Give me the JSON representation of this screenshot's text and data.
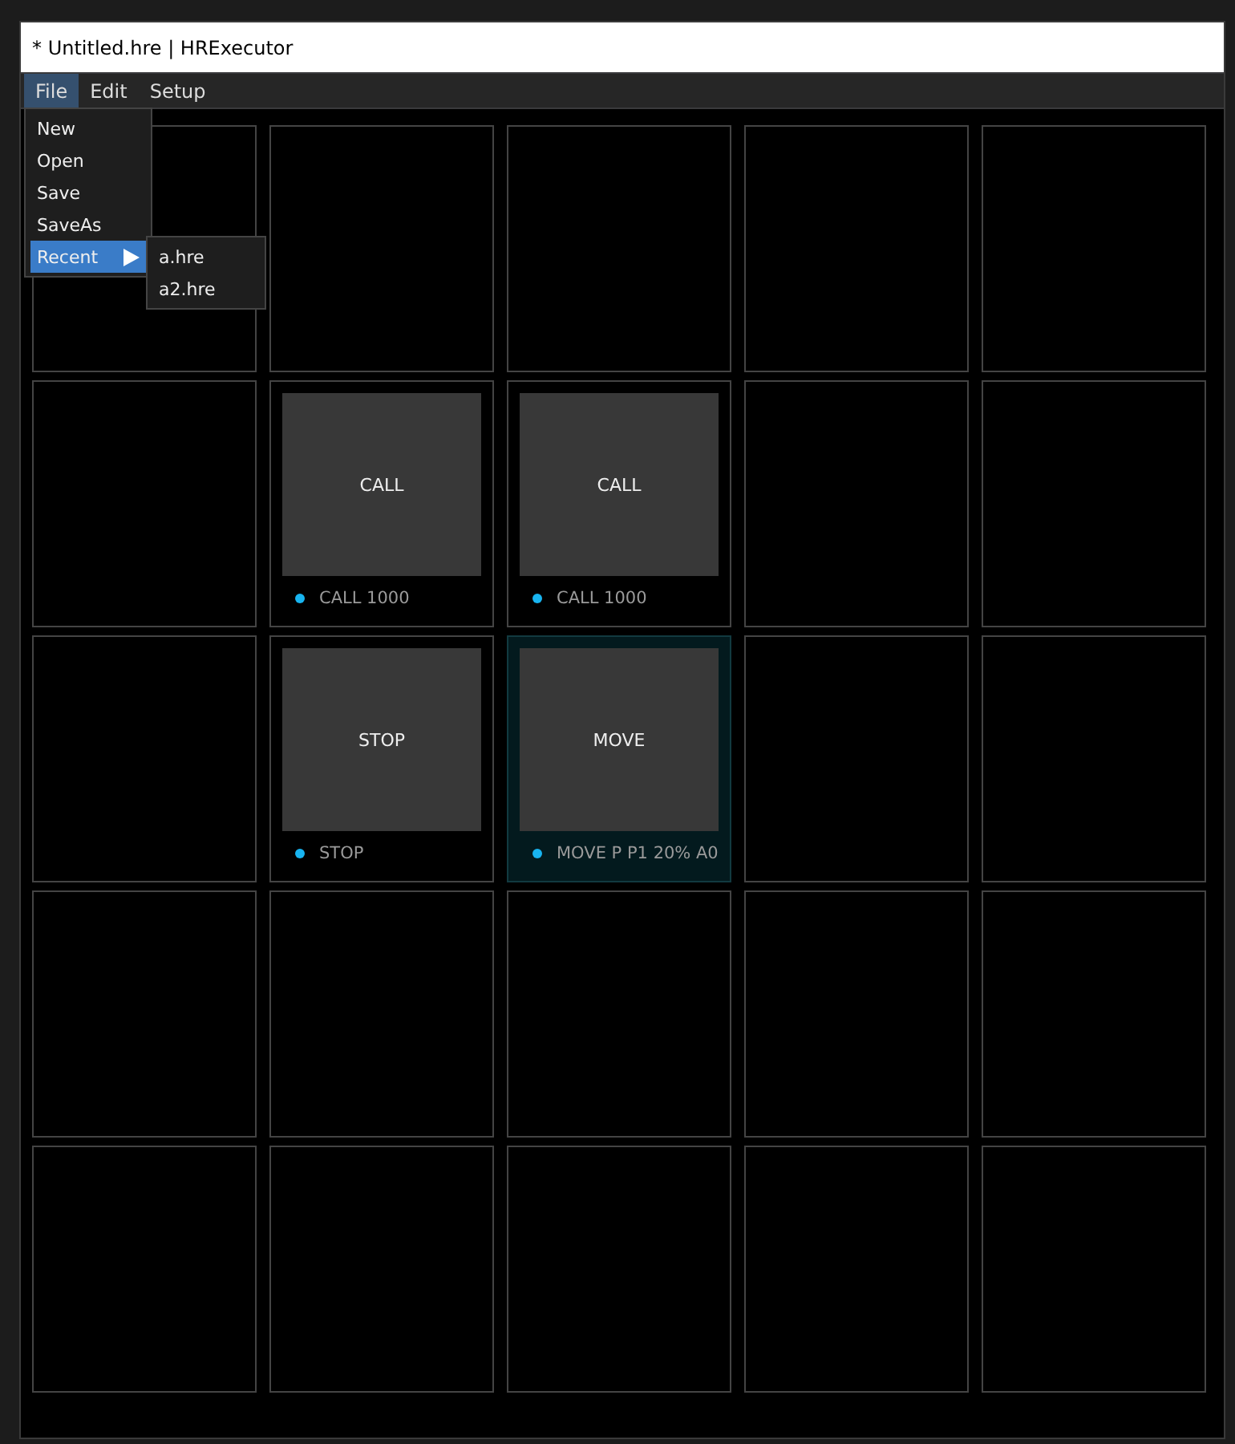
{
  "window": {
    "title": "* Untitled.hre | HRExecutor"
  },
  "menu_bar": [
    {
      "label": "File",
      "selected": true
    },
    {
      "label": "Edit",
      "selected": false
    },
    {
      "label": "Setup",
      "selected": false
    }
  ],
  "file_menu": [
    {
      "label": "New",
      "selected": false,
      "submenu": false
    },
    {
      "label": "Open",
      "selected": false,
      "submenu": false
    },
    {
      "label": "Save",
      "selected": false,
      "submenu": false
    },
    {
      "label": "SaveAs",
      "selected": false,
      "submenu": false
    },
    {
      "label": "Recent",
      "selected": true,
      "submenu": true
    }
  ],
  "recent_menu": [
    "a.hre",
    "a2.hre"
  ],
  "grid": [
    [
      {
        "kind": "empty"
      },
      {
        "kind": "empty"
      },
      {
        "kind": "empty"
      },
      {
        "kind": "empty"
      },
      {
        "kind": "empty"
      }
    ],
    [
      {
        "kind": "empty"
      },
      {
        "kind": "block",
        "label": "CALL",
        "caption": "CALL  1000",
        "selected": false
      },
      {
        "kind": "block",
        "label": "CALL",
        "caption": "CALL  1000",
        "selected": false
      },
      {
        "kind": "empty"
      },
      {
        "kind": "empty"
      }
    ],
    [
      {
        "kind": "empty"
      },
      {
        "kind": "block",
        "label": "STOP",
        "caption": "STOP",
        "selected": false
      },
      {
        "kind": "block",
        "label": "MOVE",
        "caption": "MOVE P P1 20% A0",
        "selected": true
      },
      {
        "kind": "empty"
      },
      {
        "kind": "empty"
      }
    ],
    [
      {
        "kind": "empty"
      },
      {
        "kind": "empty"
      },
      {
        "kind": "empty"
      },
      {
        "kind": "empty"
      },
      {
        "kind": "empty"
      }
    ],
    [
      {
        "kind": "empty"
      },
      {
        "kind": "empty"
      },
      {
        "kind": "empty"
      },
      {
        "kind": "empty"
      },
      {
        "kind": "empty"
      }
    ]
  ]
}
